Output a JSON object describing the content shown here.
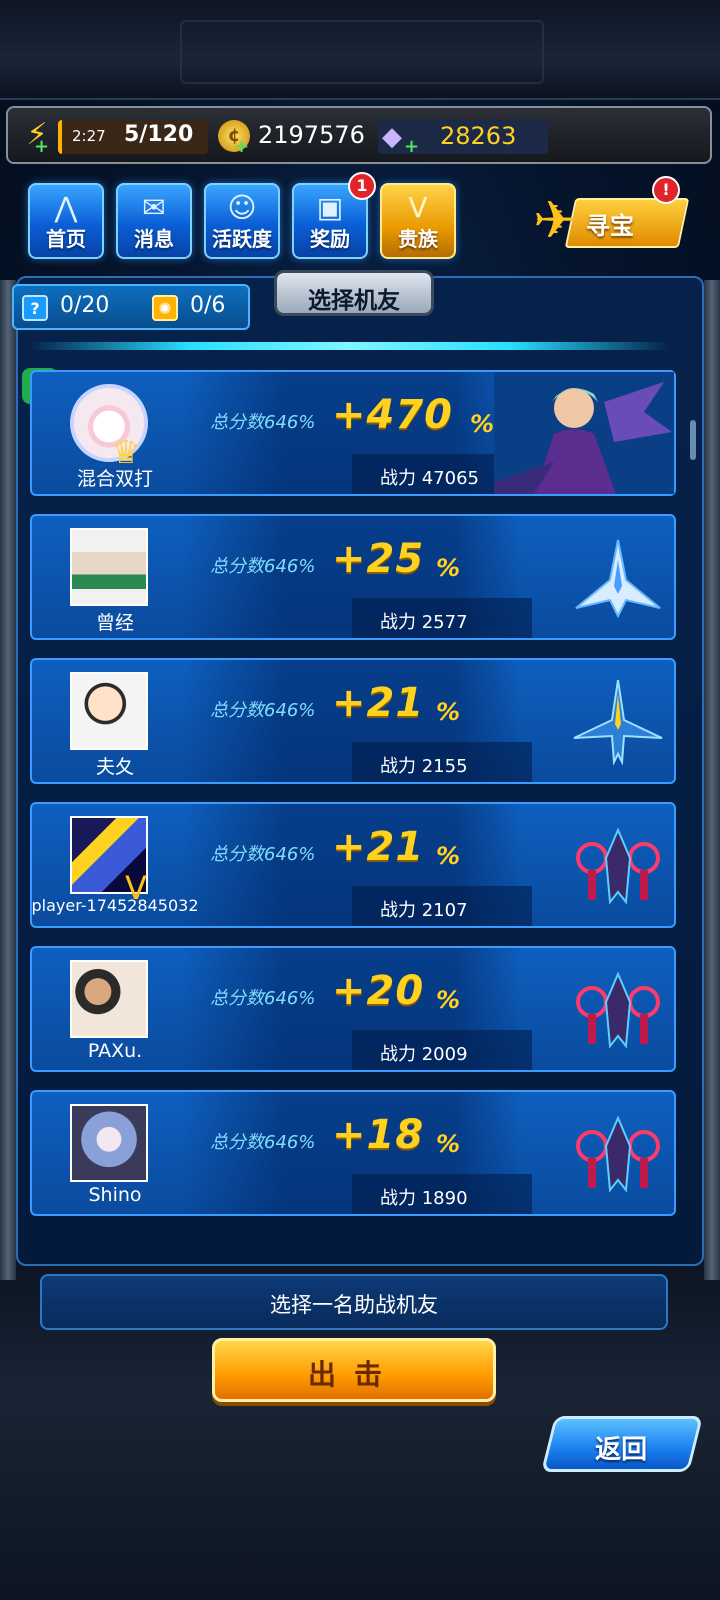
{
  "status": {
    "energy_timer": "2:27",
    "energy_count": "5/120",
    "coins": "2197576",
    "gems": "28263"
  },
  "nav": {
    "items": [
      {
        "label": "首页",
        "icon": "home-icon"
      },
      {
        "label": "消息",
        "icon": "mail-icon"
      },
      {
        "label": "活跃度",
        "icon": "smiley-icon"
      },
      {
        "label": "奖励",
        "icon": "gift-icon",
        "badge": "1"
      },
      {
        "label": "贵族",
        "icon": "noble-v-icon"
      }
    ],
    "treasure": {
      "label": "寻宝",
      "badge": "!"
    }
  },
  "panel": {
    "title": "选择机友",
    "counter_a": "0/20",
    "counter_b": "0/6"
  },
  "cards": [
    {
      "name": "混合双打",
      "score_label": "总分数646%",
      "bonus": "+470",
      "pct": "%",
      "power": "战力 47065",
      "ship": "pilot-girl"
    },
    {
      "name": "曾经",
      "score_label": "总分数646%",
      "bonus": "+25",
      "pct": "%",
      "power": "战力 2577",
      "ship": "white-jet"
    },
    {
      "name": "夫夂",
      "score_label": "总分数646%",
      "bonus": "+21",
      "pct": "%",
      "power": "战力 2155",
      "ship": "blue-jet"
    },
    {
      "name": "player-17452845032",
      "score_label": "总分数646%",
      "bonus": "+21",
      "pct": "%",
      "power": "战力 2107",
      "ship": "red-fighter"
    },
    {
      "name": "PAXu.",
      "score_label": "总分数646%",
      "bonus": "+20",
      "pct": "%",
      "power": "战力 2009",
      "ship": "red-fighter"
    },
    {
      "name": "Shino",
      "score_label": "总分数646%",
      "bonus": "+18",
      "pct": "%",
      "power": "战力 1890",
      "ship": "red-fighter"
    }
  ],
  "bottom": {
    "prompt": "选择一名助战机友",
    "launch_label": "出击",
    "back_label": "返回"
  },
  "colors": {
    "accent_gold": "#ffd21f",
    "panel_blue": "#0a4b9e",
    "cyan_text": "#7fdcff",
    "badge_red": "#e0242a"
  }
}
